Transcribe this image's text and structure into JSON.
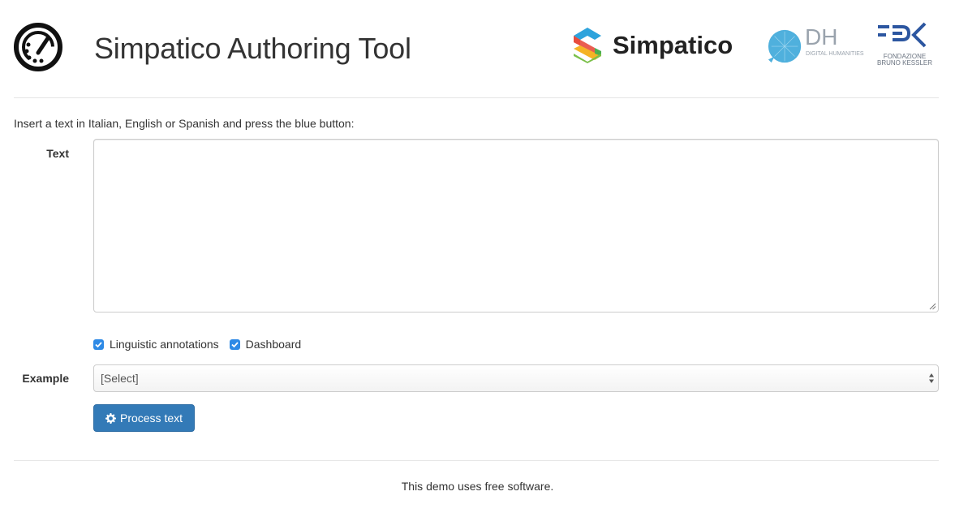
{
  "header": {
    "title": "Simpatico Authoring Tool",
    "logos": {
      "simpatico": "Simpatico",
      "dh": "DH",
      "dh_sub": "DIGITAL HUMANITIES",
      "fbk_sub_line1": "FONDAZIONE",
      "fbk_sub_line2": "BRUNO KESSLER"
    }
  },
  "form": {
    "instructions": "Insert a text in Italian, English or Spanish and press the blue button:",
    "text_label": "Text",
    "text_value": "",
    "checkboxes": [
      {
        "label": "Linguistic annotations",
        "checked": true
      },
      {
        "label": "Dashboard",
        "checked": true
      }
    ],
    "example_label": "Example",
    "example_selected": "[Select]",
    "process_button": "Process text"
  },
  "footer": {
    "text": "This demo uses free software."
  },
  "colors": {
    "primary": "#337ab7",
    "checkbox": "#2e8ae6",
    "fbk_blue": "#2c56a0",
    "dh_blue": "#4fb0dd"
  }
}
